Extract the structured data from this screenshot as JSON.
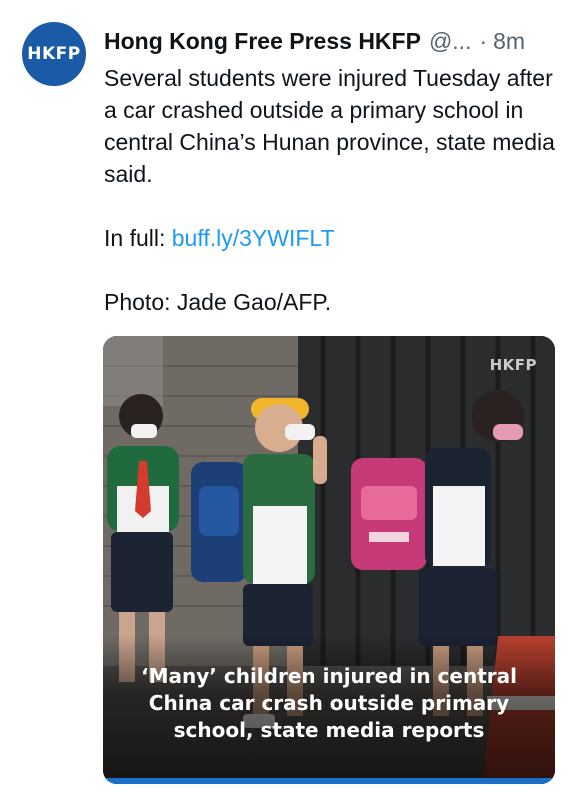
{
  "account": {
    "avatar_text": "HKFP",
    "name": "Hong Kong Free Press HKFP",
    "handle": "@...",
    "separator": "·",
    "time": "8m"
  },
  "tweet": {
    "body": "Several students were injured Tuesday after a car crashed outside a primary school in central China’s Hunan province, state media said.",
    "in_full_label": "In full: ",
    "link_text": "buff.ly/3YWIFLT",
    "photo_credit": "Photo: Jade Gao/AFP."
  },
  "media": {
    "watermark": "HKFP",
    "headline": "‘Many’ children injured in central China car crash outside primary school, state media reports"
  },
  "colors": {
    "link": "#1d9bf0",
    "avatar_bg": "#1a5aa6",
    "muted": "#536471",
    "accent_bar": "#1a6fc9"
  }
}
